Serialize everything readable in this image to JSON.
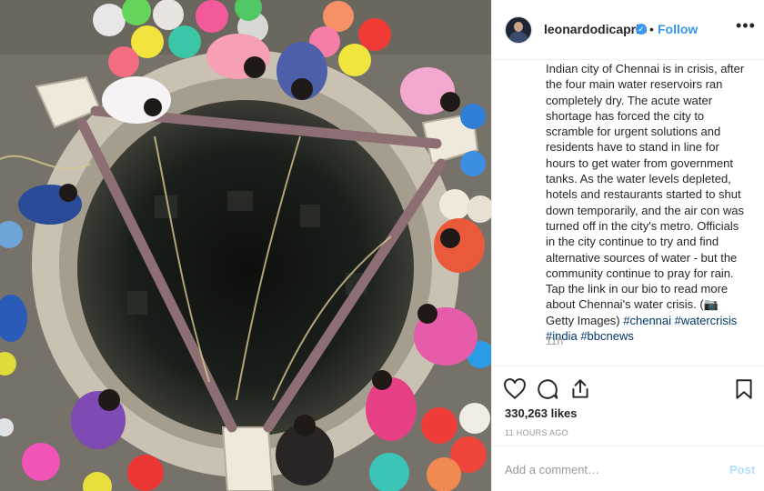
{
  "post": {
    "username": "leonardodicaprio",
    "separator": "•",
    "follow_label": "Follow",
    "more_label": "•••",
    "verified_icon": "verified-badge-icon",
    "caption_lines": [
      "Indian city of Chennai is in crisis, after",
      "the four main water reservoirs ran",
      "completely dry. The acute water",
      "shortage has forced the city to",
      "scramble for urgent solutions and",
      "residents have to stand in line for",
      "hours to get water from government",
      "tanks. As the water levels depleted,",
      "hotels and restaurants started to shut",
      "down temporarily, and the air con was",
      "turned off in the city's metro. Officials",
      "in the city continue to try and find",
      "alternative sources of water - but the",
      "community continue to pray for rain.",
      "Tap the link in our bio to read more",
      "about Chennai's water crisis. (📷"
    ],
    "caption_last_prefix": "Getty Images) ",
    "hashtags": [
      "#chennai",
      "#watercrisis",
      "#india",
      "#bbcnews"
    ],
    "relative_time": "11h",
    "likes": "330,263 likes",
    "timestamp": "11 HOURS AGO",
    "comment_placeholder": "Add a comment…",
    "post_label": "Post",
    "icons": [
      "heart-icon",
      "comment-icon",
      "share-icon",
      "bookmark-icon"
    ],
    "accent_color": "#3897f0"
  }
}
